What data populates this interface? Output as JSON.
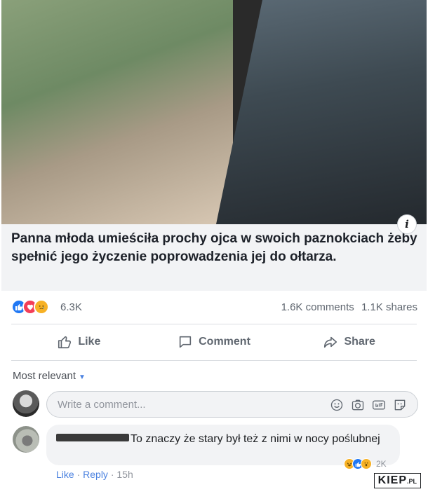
{
  "post": {
    "headline": "Panna młoda umieściła prochy ojca w swoich paznokciach żeby spełnić jego życzenie poprowadzenia jej do ołtarza.",
    "info_glyph": "i",
    "reaction_count": "6.3K",
    "comments_count": "1.6K comments",
    "shares_count": "1.1K shares",
    "reaction_icons": [
      "like",
      "love",
      "sad"
    ]
  },
  "actions": {
    "like": "Like",
    "comment": "Comment",
    "share": "Share"
  },
  "comments": {
    "sort_label": "Most relevant",
    "input_placeholder": "Write a comment...",
    "input_icons": [
      "emoji-icon",
      "camera-icon",
      "gif-icon",
      "sticker-icon"
    ],
    "items": [
      {
        "text": "To znaczy że stary był też z nimi w nocy poślubnej",
        "like": "Like",
        "reply": "Reply",
        "separator": "·",
        "time": "15h",
        "reaction_count": "2K"
      }
    ]
  },
  "watermark": {
    "main": "KIEP",
    "suffix": ".PL"
  },
  "colors": {
    "accent": "#4b82e0",
    "like_blue": "#2078f4",
    "love_red": "#f33e58",
    "sad_yellow": "#f7b125"
  }
}
